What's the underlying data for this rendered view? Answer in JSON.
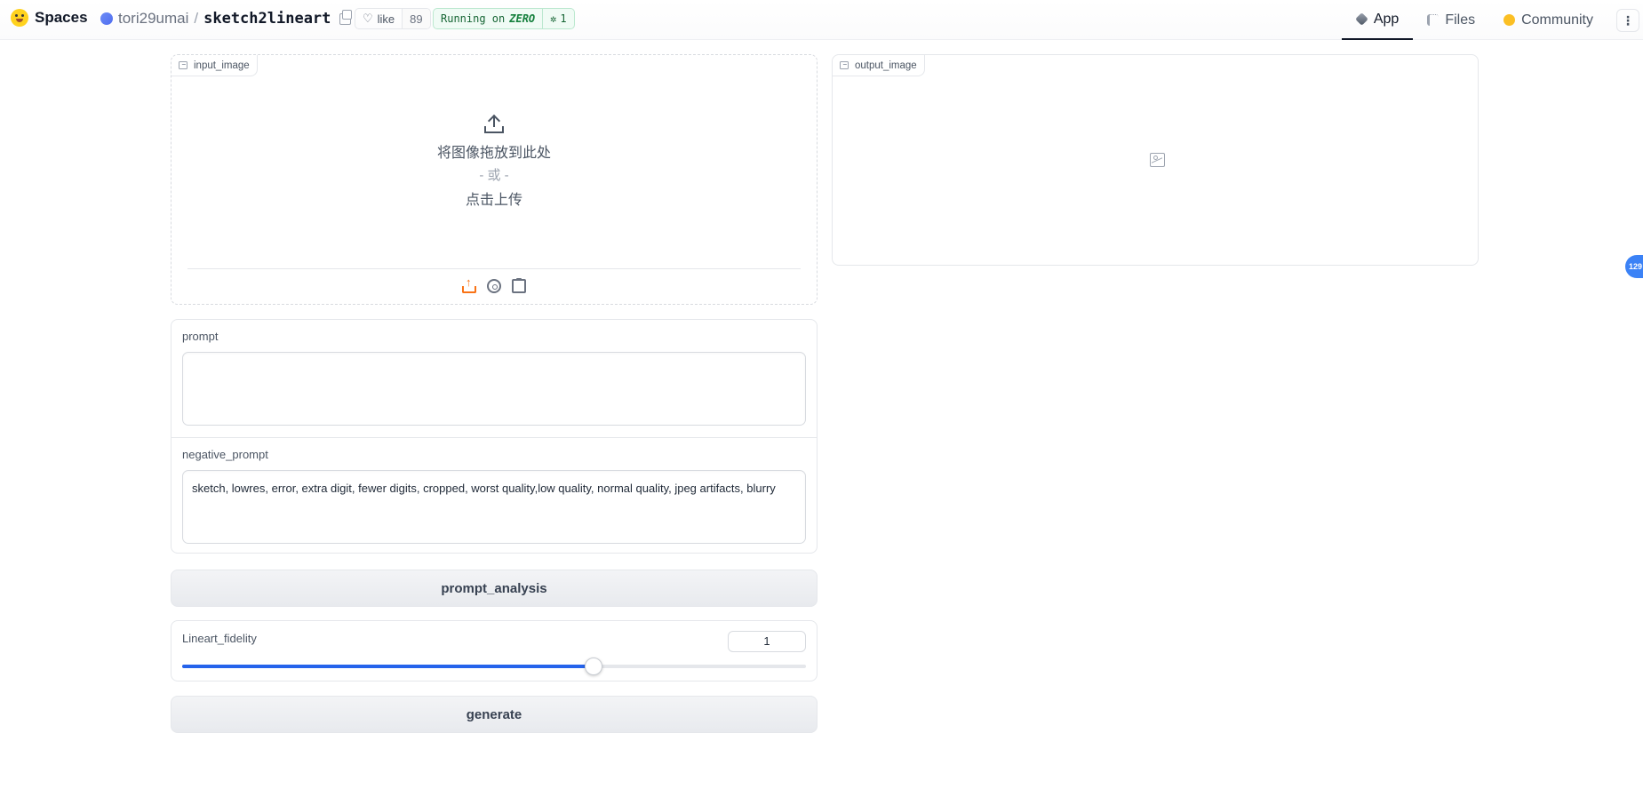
{
  "header": {
    "brand": "Spaces",
    "owner": "tori29umai",
    "space_name": "sketch2lineart",
    "like_label": "like",
    "like_count": "89",
    "running_prefix": "Running on",
    "running_hw": "ZERO",
    "hw_count": "1",
    "nav": [
      {
        "label": "App",
        "icon": "app-cube-icon"
      },
      {
        "label": "Files",
        "icon": "files-icon"
      },
      {
        "label": "Community",
        "icon": "community-icon"
      }
    ]
  },
  "input_image": {
    "label": "input_image",
    "drop_text": "将图像拖放到此处",
    "or_text": "- 或 -",
    "click_text": "点击上传"
  },
  "output_image": {
    "label": "output_image"
  },
  "prompt": {
    "label": "prompt",
    "value": ""
  },
  "negative_prompt": {
    "label": "negative_prompt",
    "value": "sketch, lowres, error, extra digit, fewer digits, cropped, worst quality,low quality, normal quality, jpeg artifacts, blurry"
  },
  "buttons": {
    "prompt_analysis": "prompt_analysis",
    "generate": "generate"
  },
  "slider": {
    "label": "Lineart_fidelity",
    "value": "1",
    "fill_fraction": 0.66
  },
  "side_badge": "129",
  "colors": {
    "accent": "#2563eb",
    "upload_orange": "#f97316",
    "running_green": "#166534"
  }
}
